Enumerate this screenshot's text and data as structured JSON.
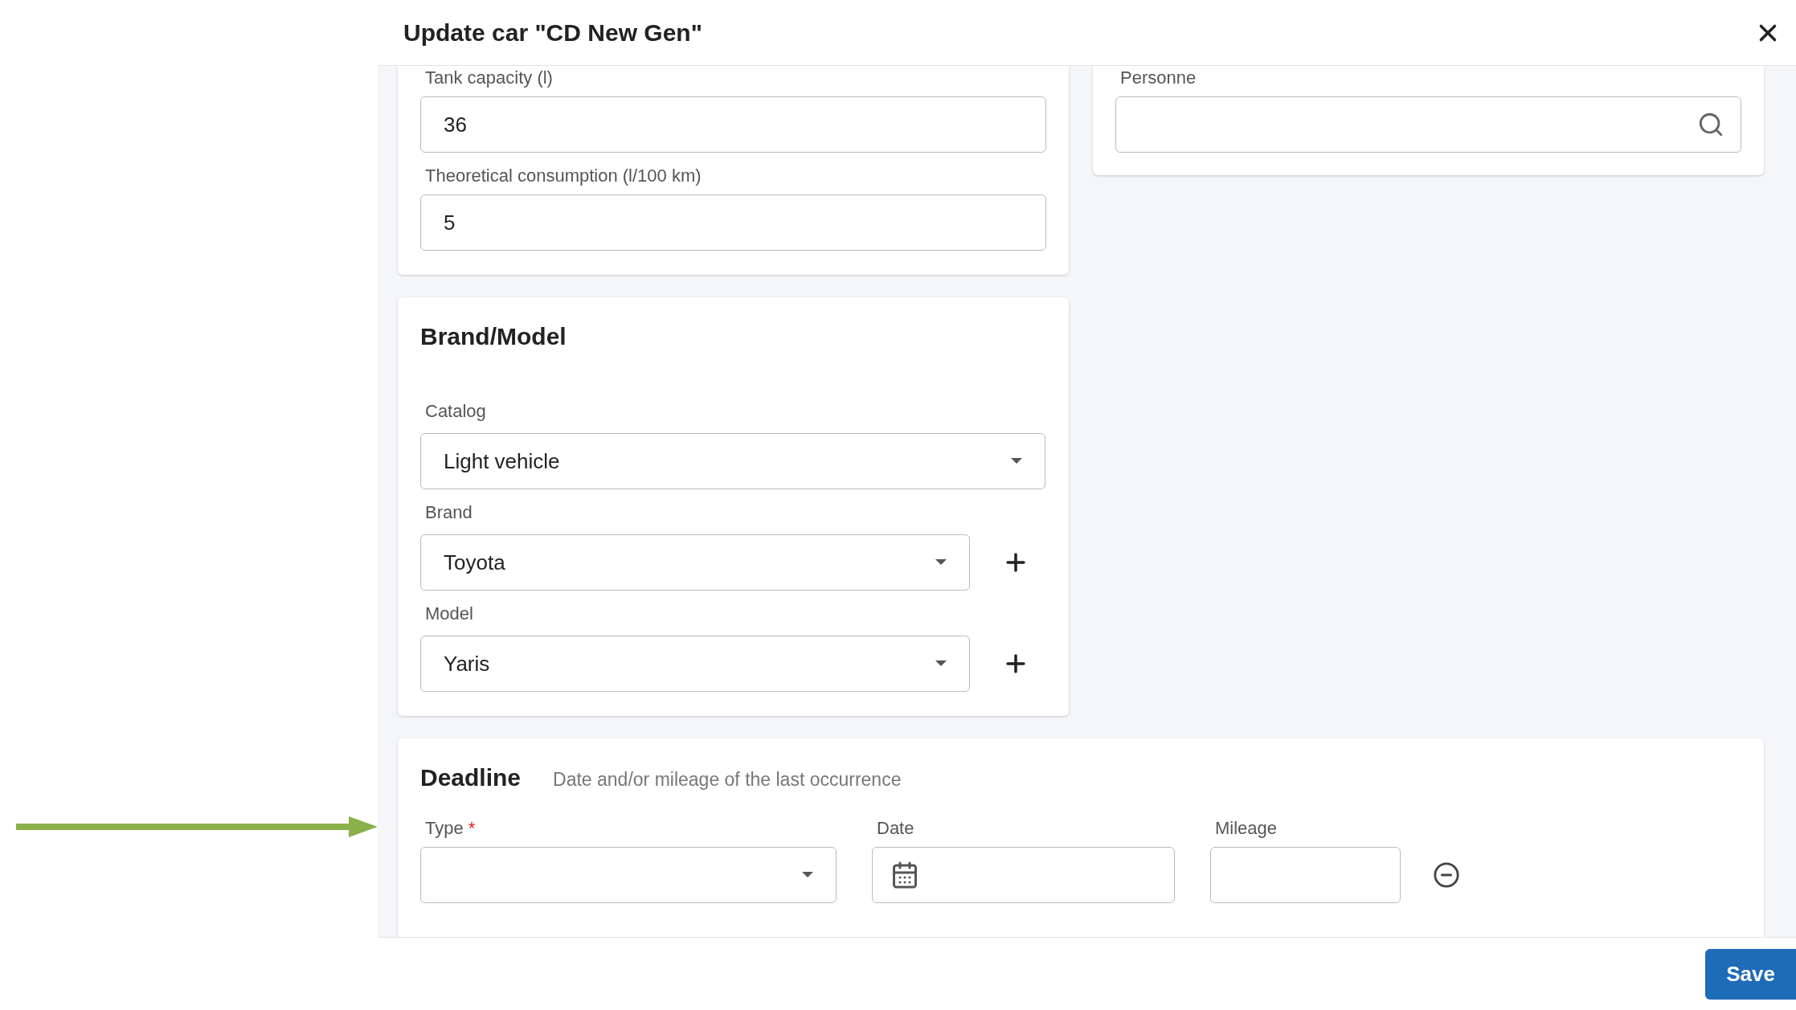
{
  "dialog": {
    "title": "Update car \"CD New Gen\""
  },
  "fuel_section": {
    "fields": [
      {
        "label": "Tank capacity (l)",
        "value": "36"
      },
      {
        "label": "Theoretical consumption (l/100 km)",
        "value": "5"
      }
    ]
  },
  "personnel_section": {
    "field": {
      "label": "Personne"
    }
  },
  "brand_model": {
    "title": "Brand/Model",
    "fields": [
      {
        "label": "Catalog",
        "value": "Light vehicle",
        "addable": false
      },
      {
        "label": "Brand",
        "value": "Toyota",
        "addable": true
      },
      {
        "label": "Model",
        "value": "Yaris",
        "addable": true
      }
    ]
  },
  "deadline": {
    "title": "Deadline",
    "hint": "Date and/or mileage of the last occurrence",
    "columns": [
      {
        "kind": "select",
        "label": "Type",
        "required_mark": "*"
      },
      {
        "kind": "date",
        "label": "Date"
      },
      {
        "kind": "text",
        "label": "Mileage"
      }
    ]
  },
  "buttons": {
    "save": "Save"
  }
}
